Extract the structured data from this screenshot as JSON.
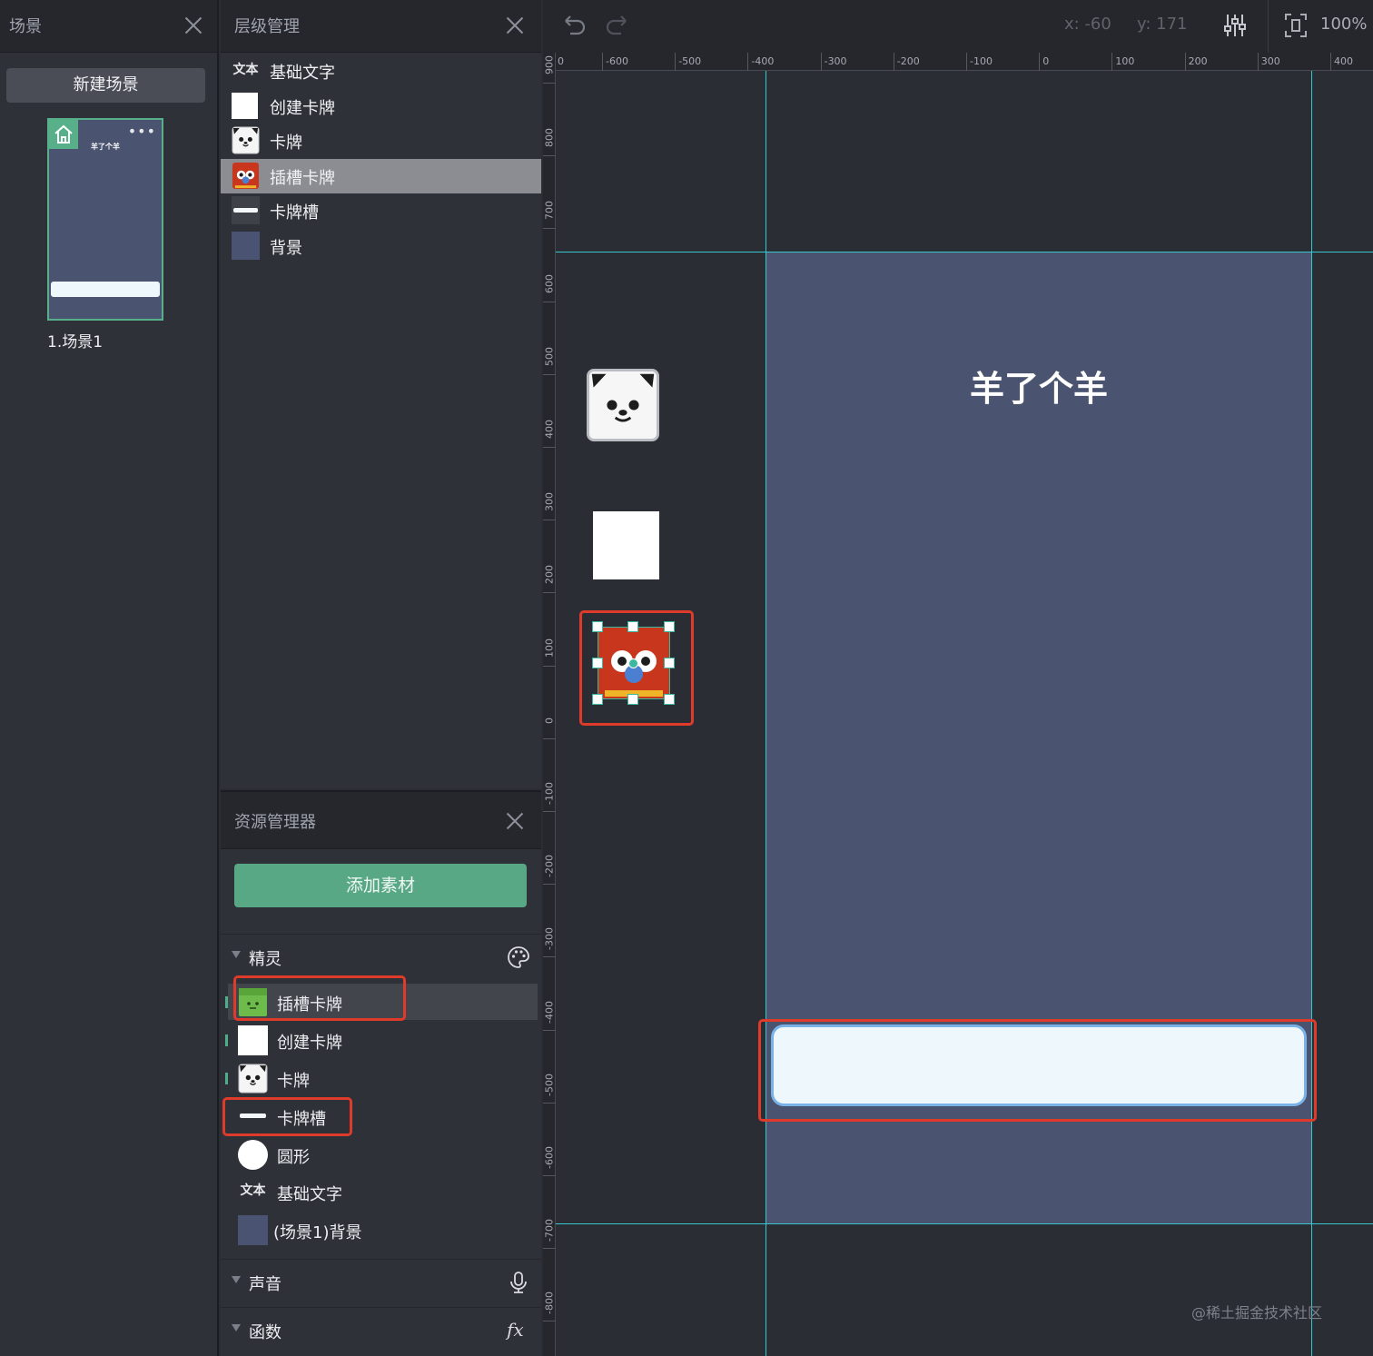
{
  "scene_panel": {
    "title": "场景",
    "new_scene_label": "新建场景",
    "thumb_title": "羊了个羊",
    "thumb_more": "•••",
    "scene_name": "1.场景1"
  },
  "layer_panel": {
    "title": "层级管理",
    "items": [
      {
        "label": "基础文字",
        "icon": "text-icon",
        "icon_text": "文本"
      },
      {
        "label": "创建卡牌",
        "icon": "white-square"
      },
      {
        "label": "卡牌",
        "icon": "panda-icon"
      },
      {
        "label": "插槽卡牌",
        "icon": "slot-card-icon",
        "selected": true
      },
      {
        "label": "卡牌槽",
        "icon": "slot-bar-icon"
      },
      {
        "label": "背景",
        "icon": "background-swatch"
      }
    ]
  },
  "resource_panel": {
    "title": "资源管理器",
    "add_asset_label": "添加素材",
    "sprites_section": "精灵",
    "sprites": [
      {
        "label": "插槽卡牌",
        "icon": "green-card-icon"
      },
      {
        "label": "创建卡牌",
        "icon": "white-square"
      },
      {
        "label": "卡牌",
        "icon": "panda-icon"
      },
      {
        "label": "卡牌槽",
        "icon": "slot-bar-icon"
      },
      {
        "label": "圆形",
        "icon": "circle-icon"
      },
      {
        "label": "基础文字",
        "icon": "text-icon",
        "icon_text": "文本"
      },
      {
        "label": "(场景1)背景",
        "icon": "background-swatch"
      }
    ],
    "sound_section": "声音",
    "function_section": "函数",
    "function_icon": "fx"
  },
  "toolbar": {
    "coord_x": "x: -60",
    "coord_y": "y: 171",
    "zoom": "100%"
  },
  "rulers": {
    "h_labels": [
      "0",
      "-600",
      "-500",
      "-400",
      "-300",
      "-200",
      "-100",
      "0",
      "100",
      "200",
      "300",
      "400"
    ],
    "v_labels": [
      "900",
      "800",
      "700",
      "600",
      "500",
      "400",
      "300",
      "200",
      "100",
      "0",
      "-100",
      "-200",
      "-300",
      "-400",
      "-500",
      "-600",
      "-700",
      "-800"
    ]
  },
  "canvas": {
    "stage_title": "羊了个羊",
    "watermark": "@稀土掘金技术社区"
  },
  "colors": {
    "accent_green": "#58a785",
    "stage_bg": "#4a5370",
    "guide": "#38c7cf",
    "highlight_red": "#e03a2b"
  }
}
